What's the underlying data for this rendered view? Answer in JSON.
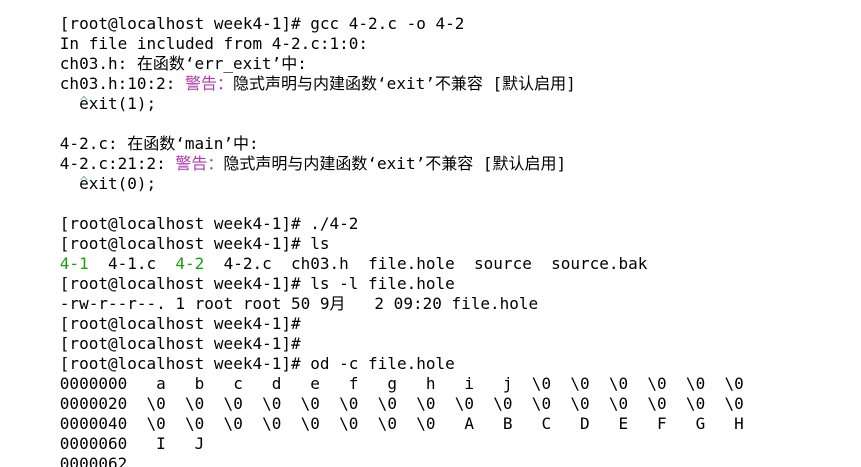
{
  "terminal": {
    "lines": [
      {
        "segments": [
          {
            "text": "[root@localhost week4-1]# gcc 4-2.c -o 4-2",
            "color": "normal"
          }
        ]
      },
      {
        "segments": [
          {
            "text": "In file included from 4-2.c:1:0:",
            "color": "normal"
          }
        ]
      },
      {
        "segments": [
          {
            "text": "ch03.h: 在函数‘err_exit’中:",
            "color": "normal"
          }
        ]
      },
      {
        "segments": [
          {
            "text": "ch03.h:10:2: ",
            "color": "normal"
          },
          {
            "text": "警告：",
            "color": "purple"
          },
          {
            "text": "隐式声明与内建函数‘exit’不兼容 [默认启用]",
            "color": "normal"
          }
        ]
      },
      {
        "segments": [
          {
            "text": "  exit(1);",
            "color": "normal"
          }
        ]
      },
      {
        "segments": [
          {
            "text": "  ^",
            "color": "faint"
          }
        ]
      },
      {
        "segments": [
          {
            "text": "4-2.c: 在函数‘main’中:",
            "color": "normal"
          }
        ]
      },
      {
        "segments": [
          {
            "text": "4-2.c:21:2: ",
            "color": "normal"
          },
          {
            "text": "警告：",
            "color": "purple"
          },
          {
            "text": "隐式声明与内建函数‘exit’不兼容 [默认启用]",
            "color": "normal"
          }
        ]
      },
      {
        "segments": [
          {
            "text": "  exit(0);",
            "color": "normal"
          }
        ]
      },
      {
        "segments": [
          {
            "text": "  ^",
            "color": "faint"
          }
        ]
      },
      {
        "segments": [
          {
            "text": "[root@localhost week4-1]# ./4-2",
            "color": "normal"
          }
        ]
      },
      {
        "segments": [
          {
            "text": "[root@localhost week4-1]# ls",
            "color": "normal"
          }
        ]
      },
      {
        "segments": [
          {
            "text": "4-1",
            "color": "green"
          },
          {
            "text": "  4-1.c  ",
            "color": "normal"
          },
          {
            "text": "4-2",
            "color": "green"
          },
          {
            "text": "  4-2.c  ch03.h  file.hole  source  source.bak",
            "color": "normal"
          }
        ]
      },
      {
        "segments": [
          {
            "text": "[root@localhost week4-1]# ls -l file.hole",
            "color": "normal"
          }
        ]
      },
      {
        "segments": [
          {
            "text": "-rw-r--r--. 1 root root 50 9月   2 09:20 file.hole",
            "color": "normal"
          }
        ]
      },
      {
        "segments": [
          {
            "text": "[root@localhost week4-1]#",
            "color": "normal"
          }
        ]
      },
      {
        "segments": [
          {
            "text": "[root@localhost week4-1]#",
            "color": "normal"
          }
        ]
      },
      {
        "segments": [
          {
            "text": "[root@localhost week4-1]# od -c file.hole",
            "color": "normal"
          }
        ]
      },
      {
        "segments": [
          {
            "text": "0000000   a   b   c   d   e   f   g   h   i   j  \\0  \\0  \\0  \\0  \\0  \\0",
            "color": "normal"
          }
        ]
      },
      {
        "segments": [
          {
            "text": "0000020  \\0  \\0  \\0  \\0  \\0  \\0  \\0  \\0  \\0  \\0  \\0  \\0  \\0  \\0  \\0  \\0",
            "color": "normal"
          }
        ]
      },
      {
        "segments": [
          {
            "text": "0000040  \\0  \\0  \\0  \\0  \\0  \\0  \\0  \\0   A   B   C   D   E   F   G   H",
            "color": "normal"
          }
        ]
      },
      {
        "segments": [
          {
            "text": "0000060   I   J",
            "color": "normal"
          }
        ]
      },
      {
        "segments": [
          {
            "text": "0000062",
            "color": "normal"
          }
        ]
      }
    ],
    "colors": {
      "background": "#ffffff",
      "normal": "#000000",
      "green": "#16a30f",
      "purple": "#b03ab0"
    }
  }
}
